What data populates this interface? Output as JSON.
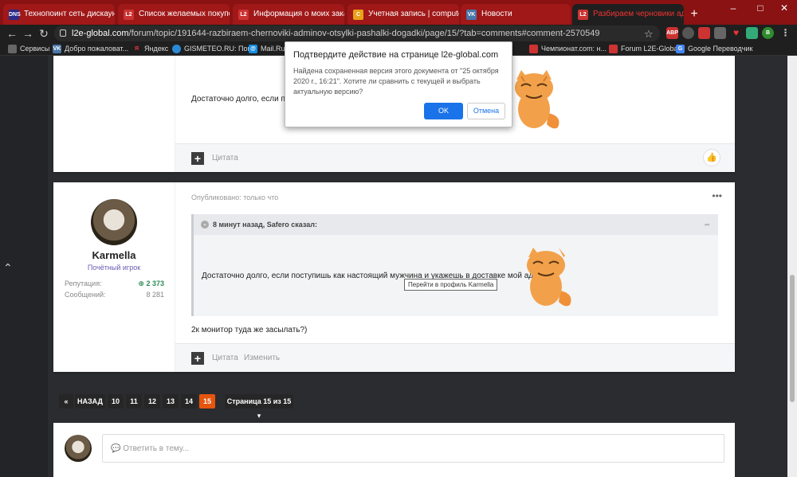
{
  "tabs": [
    {
      "title": "Технопоинт сеть дискаунтер",
      "favicon": "DNS",
      "active": false
    },
    {
      "title": "Список желаемых покупок",
      "favicon": "L2",
      "active": false
    },
    {
      "title": "Информация о моих заказах",
      "favicon": "L2",
      "active": false
    },
    {
      "title": "Учетная запись | computerun",
      "favicon": "C",
      "active": false
    },
    {
      "title": "Новости",
      "favicon": "VK",
      "active": false
    },
    {
      "title": "Разбираем черновики адм",
      "favicon": "L2",
      "active": true
    }
  ],
  "toolbar": {
    "url_host": "l2e-global.com",
    "url_path": "/forum/topic/191644-razbiraem-chernoviki-adminov-otsylki-pashalki-dogadki/page/15/?tab=comments#comment-2570549"
  },
  "bookmarks": [
    "Сервисы",
    "Добро пожаловат...",
    "Яндекс",
    "GISMETEO.RU: Пог...",
    "Mail.Ru",
    "Чемпионат.com: н...",
    "Forum L2E-Global",
    "Google Переводчик"
  ],
  "dialog": {
    "title": "Подтвердите действие на странице l2e-global.com",
    "message": "Найдена сохраненная версия этого документа от \"25 октября 2020 г., 16:21\". Хотите ли сравнить с текущей и выбрать актуальную версию?",
    "ok": "OK",
    "cancel": "Отмена"
  },
  "post1": {
    "text": "Достаточно долго, если пос",
    "quote_label": "Цитата",
    "like_icon": "thumbs-up-icon"
  },
  "post2": {
    "published": "Опубликовано: только что",
    "author": "Karmella",
    "rank": "Почётный игрок",
    "rep_label": "Репутация:",
    "rep_value": "2 373",
    "msg_label": "Сообщений:",
    "msg_value": "8 281",
    "quote_header": "8 минут назад, Safero сказал:",
    "quote_text": "Достаточно долго, если поступишь как настоящий мужчина и укажешь в доставке мой адрес.",
    "tooltip": "Перейти в профиль Karmella",
    "text": "2к монитор туда же засылать?)",
    "quote_label": "Цитата",
    "edit_label": "Изменить",
    "more": "•••"
  },
  "pagination": {
    "back": "НАЗАД",
    "pages": [
      "10",
      "11",
      "12",
      "13",
      "14",
      "15"
    ],
    "current": "15",
    "page_menu": "Страница 15 из 15"
  },
  "reply": {
    "placeholder": "Ответить в тему..."
  }
}
